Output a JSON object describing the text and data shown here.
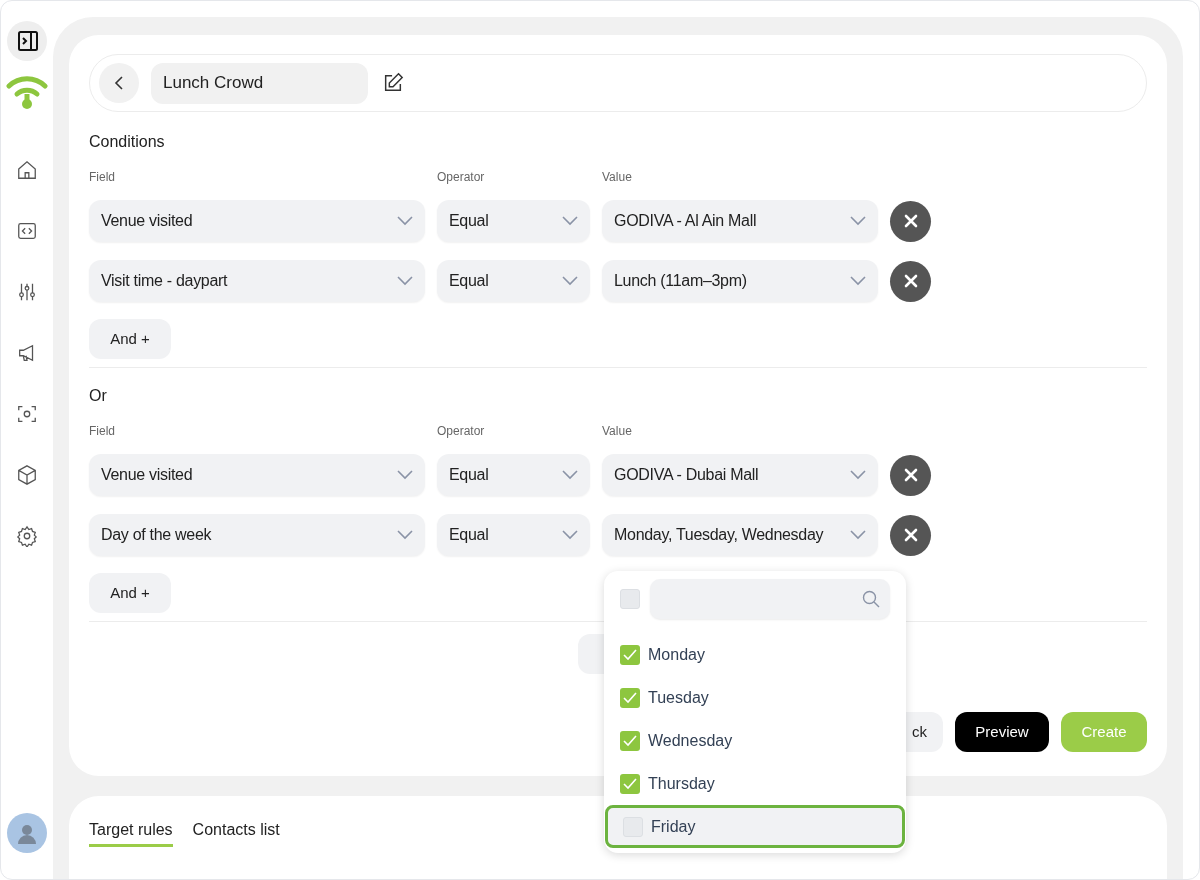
{
  "header": {
    "title": "Lunch Crowd"
  },
  "groups": [
    {
      "heading": "Conditions",
      "labels": {
        "field": "Field",
        "operator": "Operator",
        "value": "Value"
      },
      "rows": [
        {
          "field": "Venue visited",
          "operator": "Equal",
          "value": "GODIVA - Al Ain Mall"
        },
        {
          "field": "Visit time - daypart",
          "operator": "Equal",
          "value": "Lunch (11am–3pm)"
        }
      ],
      "add_button": "And +"
    },
    {
      "heading": "Or",
      "labels": {
        "field": "Field",
        "operator": "Operator",
        "value": "Value"
      },
      "rows": [
        {
          "field": "Venue visited",
          "operator": "Equal",
          "value": "GODIVA - Dubai Mall"
        },
        {
          "field": "Day of the week",
          "operator": "Equal",
          "value": "Monday, Tuesday, Wednesday"
        }
      ],
      "add_button": "And +"
    }
  ],
  "dropdown": {
    "select_all_checked": false,
    "options": [
      {
        "label": "Monday",
        "checked": true,
        "focused": false
      },
      {
        "label": "Tuesday",
        "checked": true,
        "focused": false
      },
      {
        "label": "Wednesday",
        "checked": true,
        "focused": false
      },
      {
        "label": "Thursday",
        "checked": true,
        "focused": false
      },
      {
        "label": "Friday",
        "checked": false,
        "focused": true
      }
    ]
  },
  "actions": [
    {
      "label": "ck",
      "kind": "secondary"
    },
    {
      "label": "Preview",
      "kind": "dark"
    },
    {
      "label": "Create",
      "kind": "primary"
    }
  ],
  "tabs": [
    {
      "label": "Target rules",
      "selected": true
    },
    {
      "label": "Contacts list",
      "selected": false
    }
  ]
}
